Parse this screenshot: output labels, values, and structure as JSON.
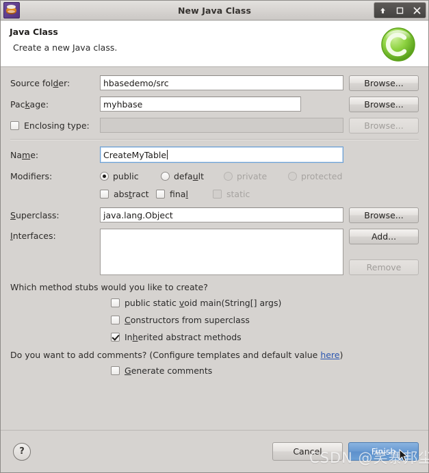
{
  "window": {
    "title": "New Java Class",
    "app_icon": "eclipse-icon",
    "controls": [
      {
        "name": "shade-button",
        "glyph": "↑"
      },
      {
        "name": "maximize-button",
        "glyph": "□"
      },
      {
        "name": "close-button",
        "glyph": "✕"
      }
    ]
  },
  "header": {
    "title": "Java Class",
    "subtitle": "Create a new Java class.",
    "badge_icon": "green-c-badge",
    "badge_letter": "C"
  },
  "form": {
    "source_folder": {
      "label": "Source folder:",
      "value": "hbasedemo/src",
      "button": "Browse..."
    },
    "package": {
      "label": "Package:",
      "value": "myhbase",
      "button": "Browse..."
    },
    "enclosing_type": {
      "label": "Enclosing type:",
      "value": "",
      "checked": false,
      "button": "Browse...",
      "disabled": true
    },
    "name": {
      "label": "Name:",
      "value": "CreateMyTable",
      "focused": true
    },
    "modifiers": {
      "label": "Modifiers:",
      "radios": [
        {
          "label": "public",
          "checked": true,
          "disabled": false
        },
        {
          "label": "default",
          "checked": false,
          "disabled": false
        },
        {
          "label": "private",
          "checked": false,
          "disabled": true
        },
        {
          "label": "protected",
          "checked": false,
          "disabled": true
        }
      ],
      "checkboxes": [
        {
          "label": "abstract",
          "checked": false,
          "disabled": false
        },
        {
          "label": "final",
          "checked": false,
          "disabled": false
        },
        {
          "label": "static",
          "checked": false,
          "disabled": true
        }
      ]
    },
    "superclass": {
      "label": "Superclass:",
      "value": "java.lang.Object",
      "button": "Browse..."
    },
    "interfaces": {
      "label": "Interfaces:",
      "items": [],
      "add_button": "Add...",
      "remove_button": "Remove",
      "remove_disabled": true
    }
  },
  "stubs": {
    "question": "Which method stubs would you like to create?",
    "options": [
      {
        "label": "public static void main(String[] args)",
        "checked": false
      },
      {
        "label": "Constructors from superclass",
        "checked": false
      },
      {
        "label": "Inherited abstract methods",
        "checked": true
      }
    ]
  },
  "comments": {
    "question_prefix": "Do you want to add comments? (Configure templates and default value ",
    "link": "here",
    "question_suffix": ")",
    "option": {
      "label": "Generate comments",
      "checked": false
    }
  },
  "footer": {
    "help_icon": "question-mark-icon",
    "help_glyph": "?",
    "cancel_label": "Cancel",
    "finish_label": "Finish"
  },
  "watermark": {
    "text": "CSDN @笑寨邦尘"
  },
  "colors": {
    "dialog_bg": "#d6d3d0",
    "header_bg": "#ffffff",
    "accent_blue": "#6a9bd2",
    "link_blue": "#2b56b0",
    "badge_green": "#6cc024"
  }
}
